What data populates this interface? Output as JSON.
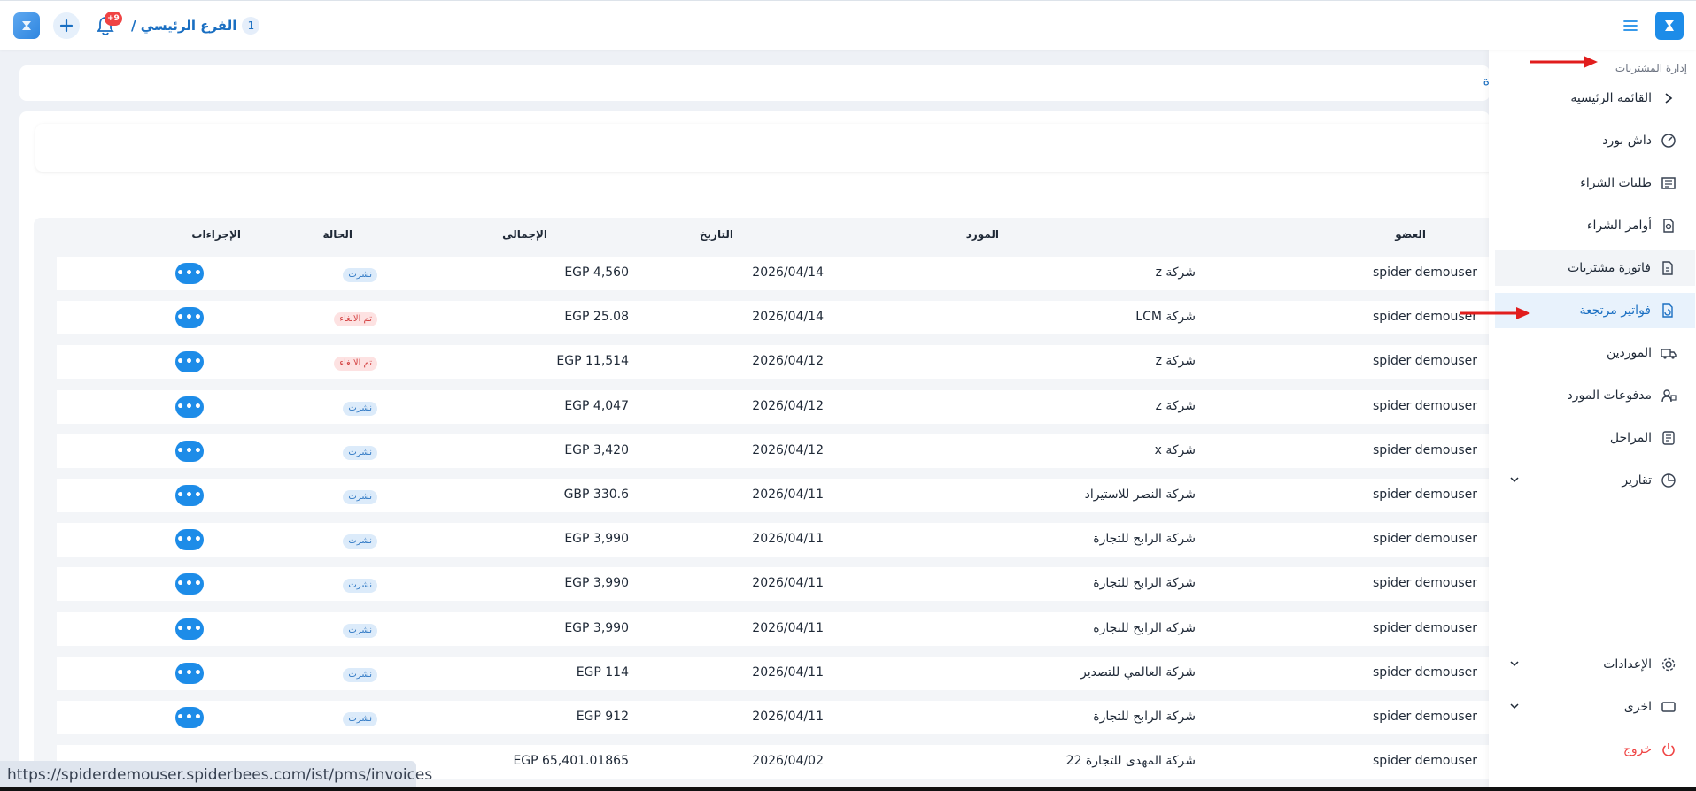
{
  "topbar": {
    "notifications_count": "+9",
    "branch_number": "1",
    "branch_name": "الفرع الرئيسي /"
  },
  "sidebar": {
    "section_title": "إدارة المشتريات",
    "items": [
      {
        "label": "القائمة الرئيسية"
      },
      {
        "label": "داش بورد"
      },
      {
        "label": "طلبات الشراء"
      },
      {
        "label": "أوامر الشراء"
      },
      {
        "label": "فاتورة مشتريات"
      },
      {
        "label": "فواتير مرتجعة"
      },
      {
        "label": "الموردين"
      },
      {
        "label": "مدفوعات المورد"
      },
      {
        "label": "المراحل"
      },
      {
        "label": "تقارير"
      },
      {
        "label": "الإعدادات"
      },
      {
        "label": "اخرى"
      },
      {
        "label": "خروج"
      }
    ]
  },
  "breadcrumb_link": "ة",
  "table": {
    "headers": {
      "member": "العضو",
      "supplier": "المورد",
      "date": "التاريخ",
      "total": "الإجمالى",
      "status": "الحالة",
      "actions": "الإجراءات"
    },
    "action_label": "•••",
    "rows": [
      {
        "member": "spider demouser",
        "supplier": "شركة z",
        "date": "2026/04/14",
        "total": "EGP 4,560",
        "status": "نشرت",
        "status_type": "published"
      },
      {
        "member": "spider demouser",
        "supplier": "شركة LCM",
        "date": "2026/04/14",
        "total": "EGP 25.08",
        "status": "تم الالغاء",
        "status_type": "cancelled"
      },
      {
        "member": "spider demouser",
        "supplier": "شركة z",
        "date": "2026/04/12",
        "total": "EGP 11,514",
        "status": "تم الالغاء",
        "status_type": "cancelled"
      },
      {
        "member": "spider demouser",
        "supplier": "شركة z",
        "date": "2026/04/12",
        "total": "EGP 4,047",
        "status": "نشرت",
        "status_type": "published"
      },
      {
        "member": "spider demouser",
        "supplier": "شركة x",
        "date": "2026/04/12",
        "total": "EGP 3,420",
        "status": "نشرت",
        "status_type": "published"
      },
      {
        "member": "spider demouser",
        "supplier": "شركة النصر للاستيراد",
        "date": "2026/04/11",
        "total": "GBP 330.6",
        "status": "نشرت",
        "status_type": "published"
      },
      {
        "member": "spider demouser",
        "supplier": "شركة الرابح للتجارة",
        "date": "2026/04/11",
        "total": "EGP 3,990",
        "status": "نشرت",
        "status_type": "published"
      },
      {
        "member": "spider demouser",
        "supplier": "شركة الرابح للتجارة",
        "date": "2026/04/11",
        "total": "EGP 3,990",
        "status": "نشرت",
        "status_type": "published"
      },
      {
        "member": "spider demouser",
        "supplier": "شركة الرابح للتجارة",
        "date": "2026/04/11",
        "total": "EGP 3,990",
        "status": "نشرت",
        "status_type": "published"
      },
      {
        "member": "spider demouser",
        "supplier": "شركة العالمي للتصدير",
        "date": "2026/04/11",
        "total": "EGP 114",
        "status": "نشرت",
        "status_type": "published"
      },
      {
        "member": "spider demouser",
        "supplier": "شركة الرابح للتجارة",
        "date": "2026/04/11",
        "total": "EGP 912",
        "status": "نشرت",
        "status_type": "published"
      },
      {
        "member": "spider demouser",
        "supplier": "شركة المهدى للتجارة 22",
        "date": "2026/04/02",
        "total": "EGP 65,401.01865",
        "status": "",
        "status_type": "none"
      }
    ]
  },
  "status_url": "https://spiderdemouser.spiderbees.com/ist/pms/invoices",
  "colors": {
    "primary": "#1d8ce8",
    "published_bg": "#dcebfa",
    "cancelled_bg": "#fde2e2",
    "arrow": "#e11d1d"
  }
}
